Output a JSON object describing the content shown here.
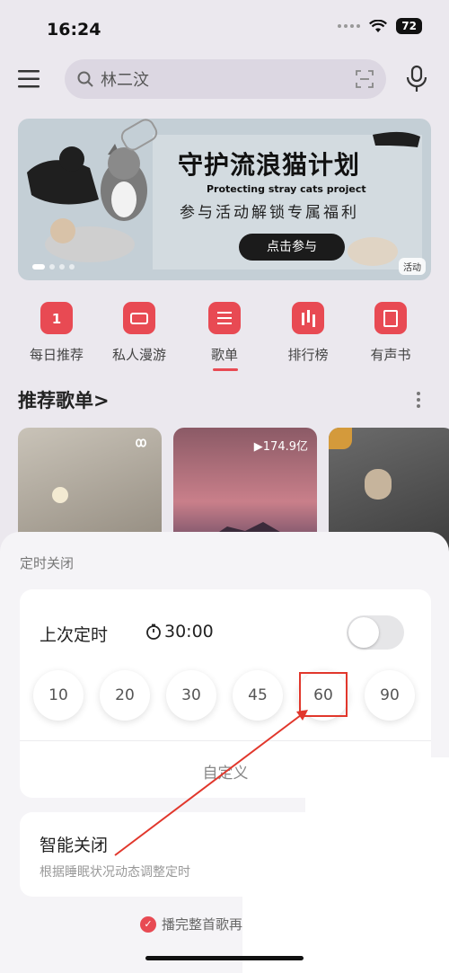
{
  "status": {
    "time": "16:24",
    "battery": "72"
  },
  "search": {
    "query": "林二汶"
  },
  "banner": {
    "title": "守护流浪猫计划",
    "subtitle": "Protecting stray cats project",
    "desc": "参与活动解锁专属福利",
    "button": "点击参与",
    "tag": "活动"
  },
  "categories": [
    {
      "label": "每日推荐",
      "icon": "calendar-icon"
    },
    {
      "label": "私人漫游",
      "icon": "radio-icon"
    },
    {
      "label": "歌单",
      "icon": "playlist-icon"
    },
    {
      "label": "排行榜",
      "icon": "chart-icon"
    },
    {
      "label": "有声书",
      "icon": "book-icon"
    }
  ],
  "recommend": {
    "title": "推荐歌单",
    "arrow": ">",
    "cards": [
      {
        "plays": ""
      },
      {
        "plays": "174.9亿"
      },
      {
        "plays": ""
      }
    ]
  },
  "timer_sheet": {
    "title": "定时关闭",
    "last_label": "上次定时",
    "last_value": "30:00",
    "toggle_on": false,
    "options": [
      "10",
      "20",
      "30",
      "45",
      "60",
      "90"
    ],
    "highlighted_option": "60",
    "custom": "自定义",
    "smart_title": "智能关闭",
    "smart_desc": "根据睡眠状况动态调整定时",
    "finish_text": "播完整首歌再"
  },
  "colors": {
    "accent": "#e84a53",
    "annotation": "#e1372c"
  }
}
